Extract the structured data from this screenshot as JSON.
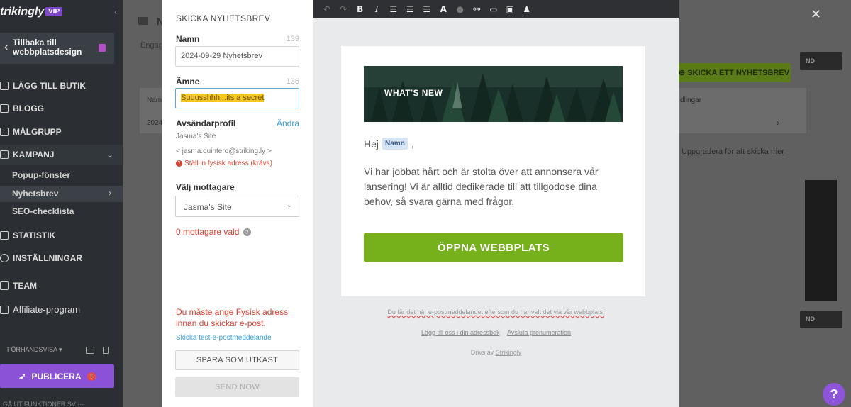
{
  "sidebar": {
    "brand": "trikingly",
    "vip": "VIP",
    "back_label": "Tillbaka till webbplatsdesign",
    "items": [
      {
        "label": "LÄGG TILL BUTIK"
      },
      {
        "label": "BLOGG"
      },
      {
        "label": "MÅLGRUPP"
      },
      {
        "label": "KAMPANJ"
      },
      {
        "label": "Popup-fönster"
      },
      {
        "label": "Nyhetsbrev"
      },
      {
        "label": "SEO-checklista"
      },
      {
        "label": "STATISTIK"
      },
      {
        "label": "INSTÄLLNINGAR"
      },
      {
        "label": "TEAM"
      },
      {
        "label": "Affiliate-program"
      }
    ],
    "preview": "FÖRHANDSVISA",
    "publish": "PUBLICERA",
    "footer": "GÅ UT     FUNKTIONER     SV   ···"
  },
  "dashboard": {
    "title": "N",
    "subtitle": "Engag",
    "col_name": "Nam",
    "col_settings": "dlingar",
    "row_date": "2024",
    "send_button": "SKICKA ETT NYHETSBREV",
    "send_dark": "ND",
    "upgrade": "Uppgradera för att skicka mer"
  },
  "form": {
    "title": "SKICKA NYHETSBREV",
    "name_label": "Namn",
    "name_count": "139",
    "name_value": "2024-09-29 Nyhetsbrev",
    "subject_label": "Ämne",
    "subject_count": "136",
    "subject_value": "Suuusshhh...its a secret",
    "sender_label": "Avsändarprofil",
    "change_link": "Ändra",
    "sender_name": "Jasma's Site",
    "sender_email": "< jasma.quintero@striking.ly >",
    "address_error": "Ställ in fysisk adress (krävs)",
    "recipients_label": "Välj mottagare",
    "recipients_value": "Jasma's Site",
    "recipients_count": "0 mottagare vald",
    "address_required": "Du måste ange Fysisk adress innan du skickar e-post.",
    "test_link": "Skicka test-e-postmeddelande",
    "draft_button": "SPARA SOM UTKAST",
    "send_button": "SEND NOW"
  },
  "email": {
    "hero_text": "WHAT'S NEW",
    "greeting": "Hej",
    "name_token": "Namn",
    "greeting_end": ",",
    "body": "Vi har jobbat hårt och är stolta över att annonsera vår lansering! Vi är alltid dedikerade till att tillgodose dina behov, så svara gärna med frågor.",
    "cta": "ÖPPNA WEBBPLATS",
    "footer_line1": "Du får det här e-postmeddelandet eftersom du har valt det via vår webbplats.",
    "footer_add": "Lägg till oss i din adressbok",
    "footer_unsub": "Avsluta prenumeration",
    "footer_powered": "Drivs av",
    "footer_brand": "Strikingly"
  },
  "colors": {
    "accent_green": "#76b01b",
    "accent_purple": "#8b51d6",
    "error_red": "#d9412f",
    "link_blue": "#3aa0d8"
  }
}
